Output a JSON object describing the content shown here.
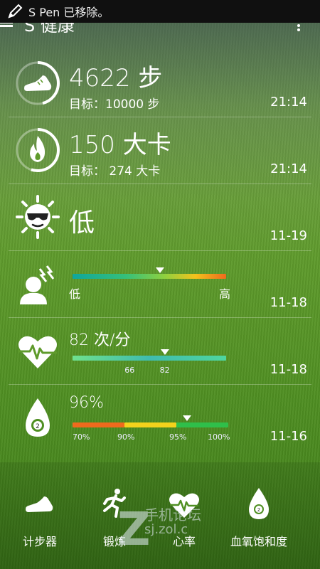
{
  "status_bar": {
    "message": "S Pen 已移除。"
  },
  "app_bar": {
    "title": "S 健康"
  },
  "pedometer": {
    "value": "4622 步",
    "goal": "目标：10000 步",
    "time": "21:14",
    "progress": 0.46
  },
  "calories": {
    "value": "150 大卡",
    "goal": "目标： 274 大卡",
    "time": "21:14",
    "progress": 0.55
  },
  "uv": {
    "value": "低",
    "time": "11-19"
  },
  "stress": {
    "low_label": "低",
    "high_label": "高",
    "time": "11-18",
    "level": 0.57
  },
  "heart_rate": {
    "value": "82 次/分",
    "tick_low": "66",
    "tick_high": "82",
    "time": "11-18",
    "range_min": 40,
    "range_max": 110
  },
  "spo2": {
    "value": "96%",
    "ticks": [
      "70%",
      "90%",
      "95%",
      "100%"
    ],
    "time": "11-16",
    "reading": 96
  },
  "tabs": [
    {
      "label": "计步器",
      "icon": "shoe-icon"
    },
    {
      "label": "锻炼",
      "icon": "runner-icon"
    },
    {
      "label": "心率",
      "icon": "heart-rate-icon"
    },
    {
      "label": "血氧饱和度",
      "icon": "oxygen-drop-icon"
    }
  ],
  "watermark": {
    "line1": "手机论坛",
    "line2": "sj.zol.c"
  }
}
